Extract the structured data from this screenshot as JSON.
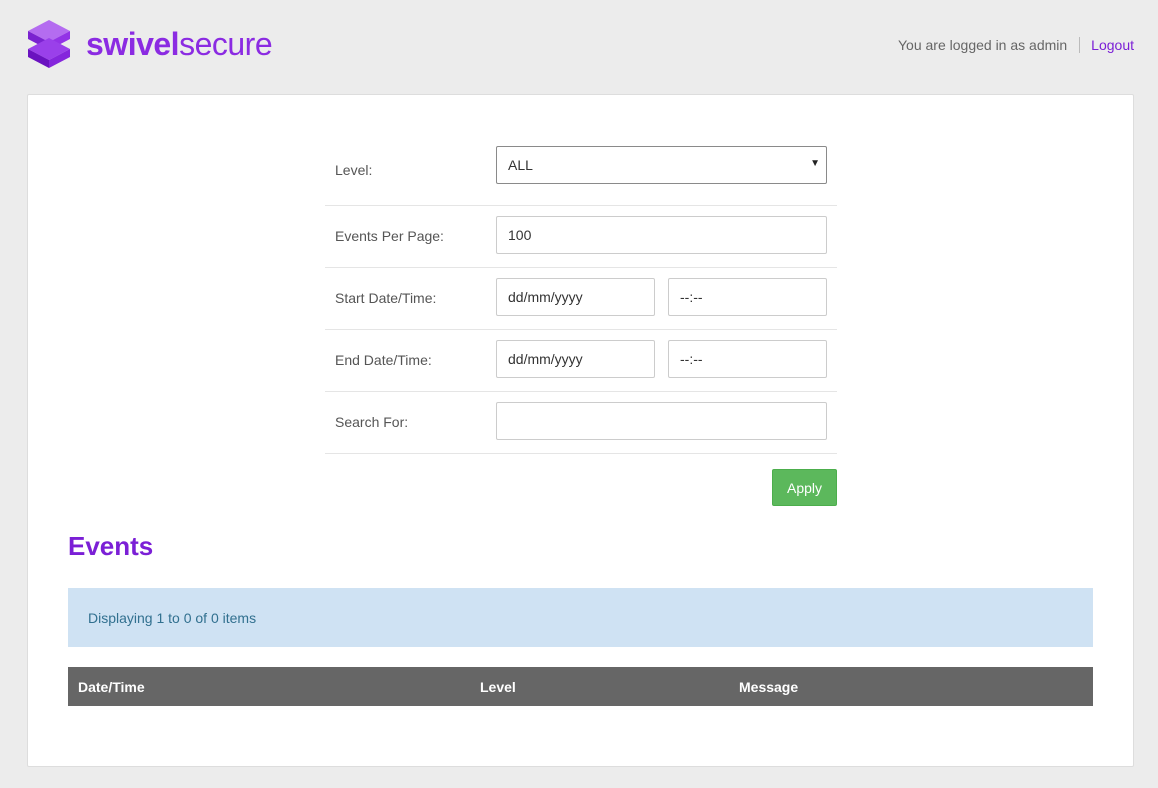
{
  "header": {
    "brand_part1": "swivel",
    "brand_part2": "secure",
    "logged_in_text": "You are logged in as admin",
    "logout_label": "Logout",
    "brand_color": "#8b2be2"
  },
  "filters": {
    "level_label": "Level:",
    "level_value": "ALL",
    "per_page_label": "Events Per Page:",
    "per_page_value": "100",
    "start_label": "Start Date/Time:",
    "start_date": "dd/mm/yyyy",
    "start_time": "--:--",
    "end_label": "End Date/Time:",
    "end_date": "dd/mm/yyyy",
    "end_time": "--:--",
    "search_label": "Search For:",
    "search_value": "",
    "apply_label": "Apply"
  },
  "events": {
    "title": "Events",
    "info": "Displaying 1 to 0 of 0 items",
    "columns": [
      "Date/Time",
      "Level",
      "Message"
    ]
  },
  "colors": {
    "accent": "#7b1fd6",
    "apply": "#5cb85c",
    "info_bg": "#cfe2f3",
    "table_header": "#666666"
  }
}
